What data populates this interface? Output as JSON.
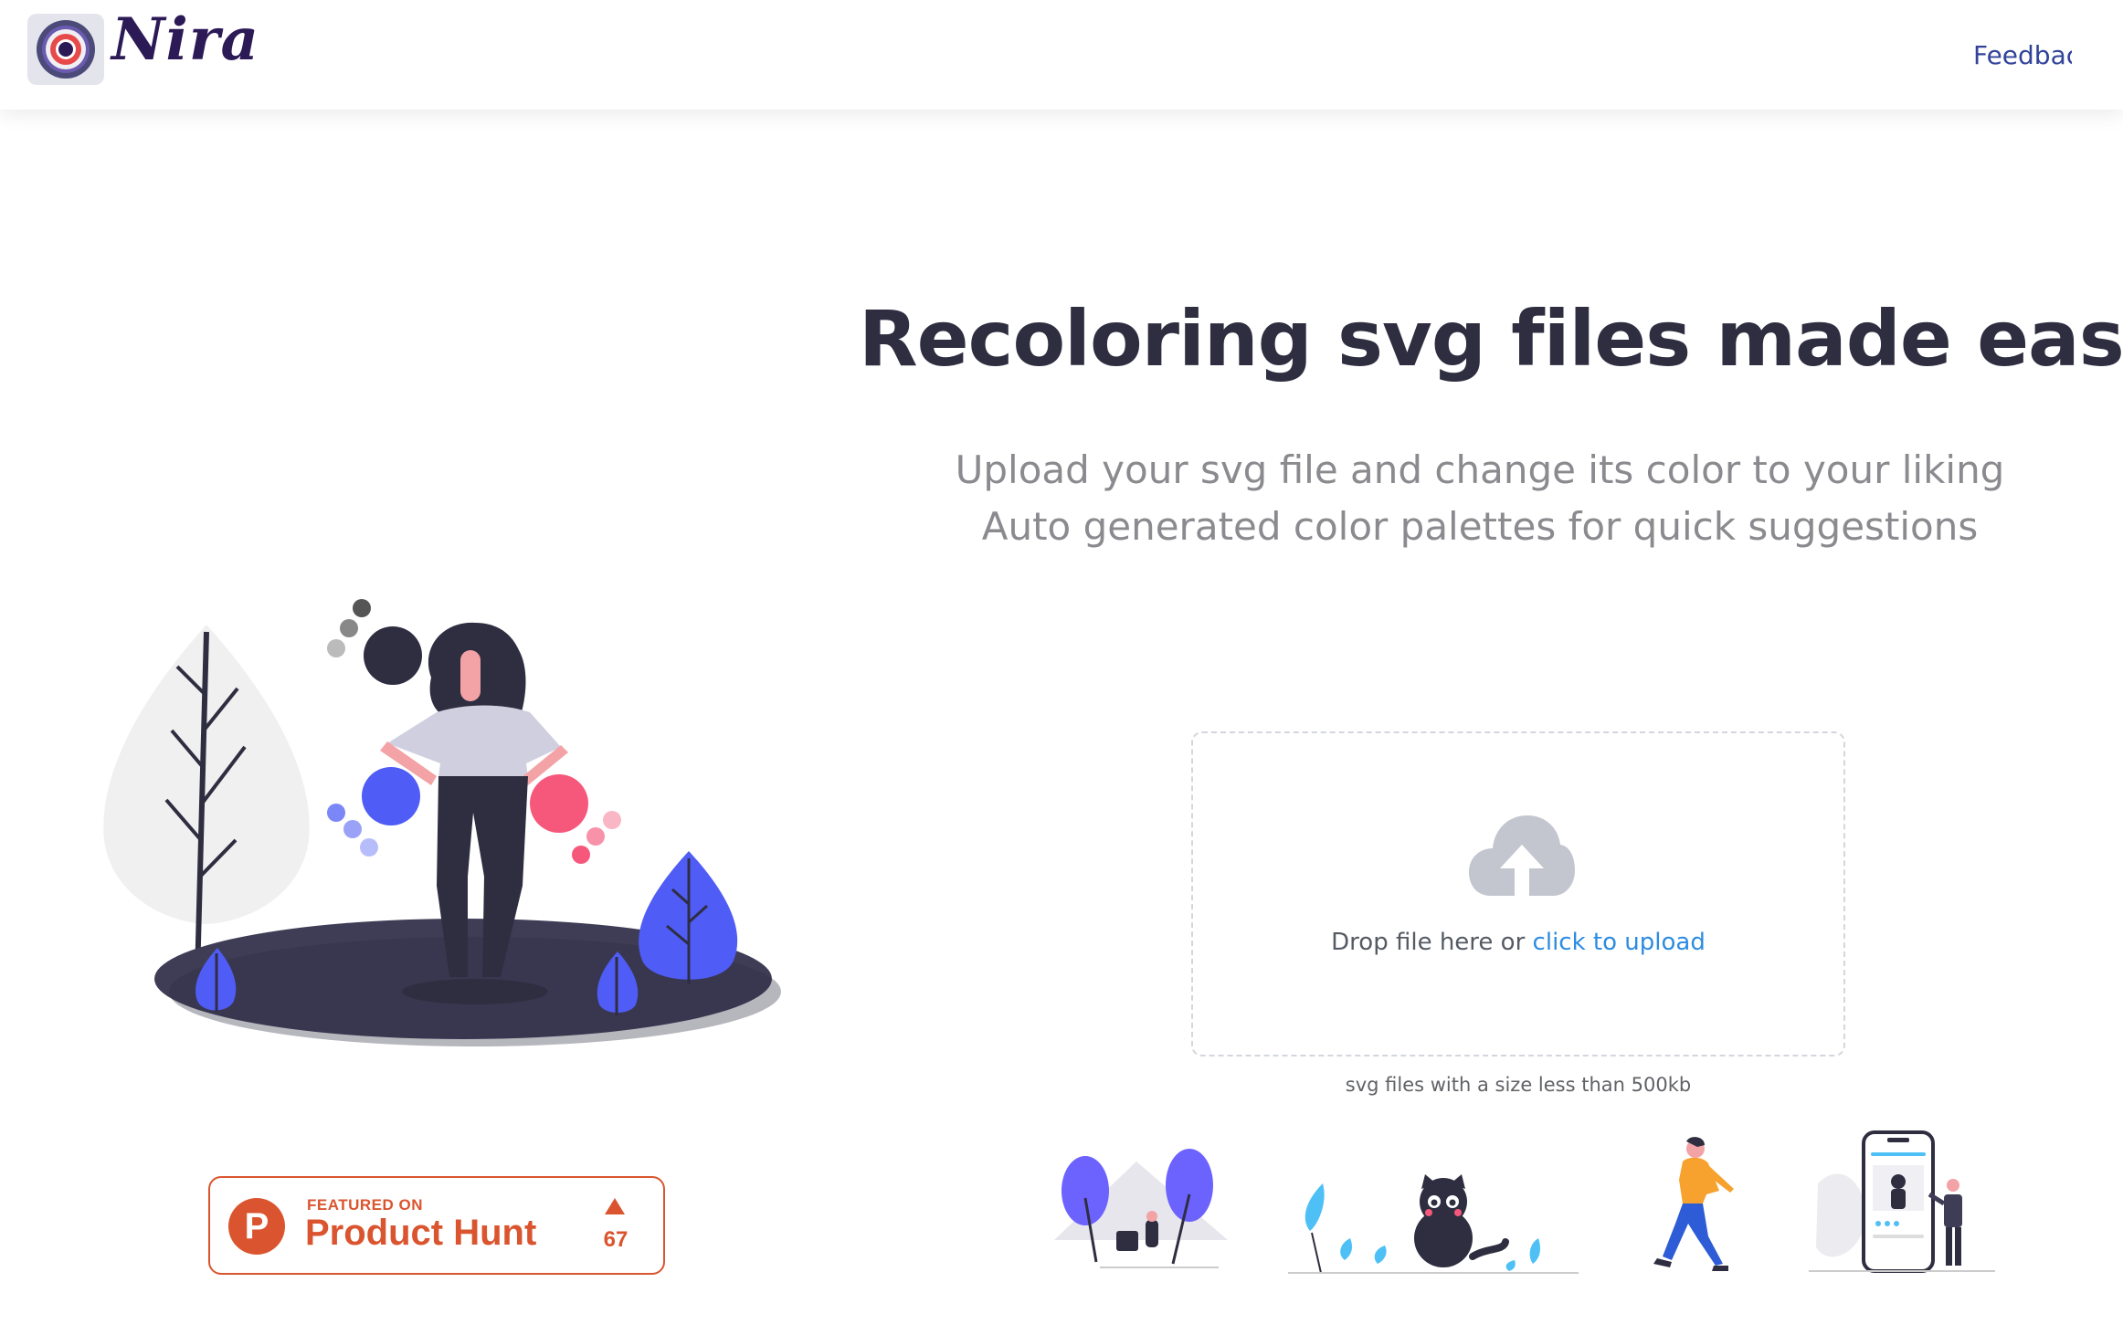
{
  "header": {
    "brand": "Nira",
    "feedback_label": "Feedback"
  },
  "hero": {
    "headline": "Recoloring svg files made easy!",
    "subtitle_line1": "Upload your svg file and change its color to your liking",
    "subtitle_line2": "Auto generated color palettes for quick suggestions"
  },
  "upload": {
    "drop_text": "Drop file here or ",
    "link_text": "click to upload",
    "hint": "svg files with a size less than 500kb"
  },
  "product_hunt": {
    "featured": "FEATURED ON",
    "name": "Product Hunt",
    "count": "67",
    "logo_letter": "P"
  },
  "colors": {
    "accent": "#4f5cf5",
    "dark": "#2f2e41",
    "pink": "#f5587b",
    "link": "#2d8ce0",
    "product_hunt": "#da552f"
  },
  "icons": [
    "logo-icon",
    "mail-icon",
    "upload-cloud-icon"
  ]
}
